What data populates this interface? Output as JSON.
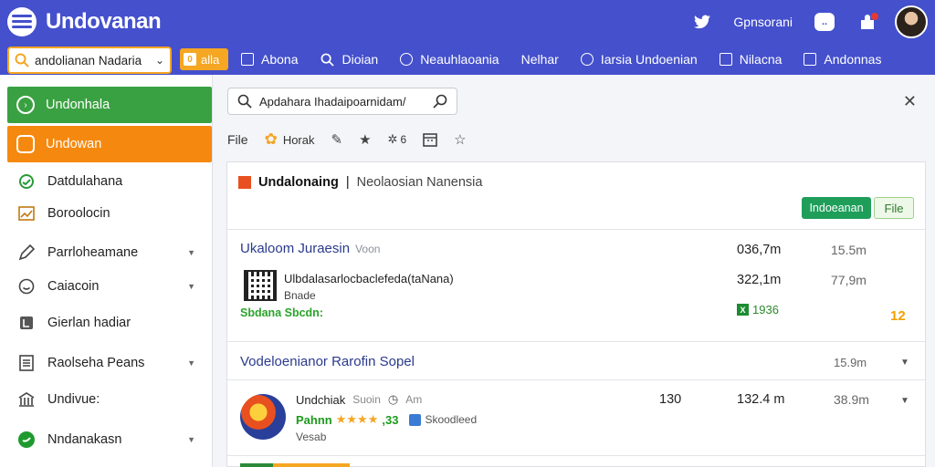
{
  "app": {
    "title": "Undovanan"
  },
  "header": {
    "right_link": "Gpnsorani",
    "chat_icon_text": "..",
    "select": {
      "value": "andolianan Nadaria"
    },
    "badge_button": {
      "label": "alla",
      "icon_text": "0"
    },
    "nav": [
      {
        "label": "Abona",
        "icon": "box-icon"
      },
      {
        "label": "Dioian",
        "icon": "search-icon"
      },
      {
        "label": "Neauhlaoania",
        "icon": "circle-check-icon"
      },
      {
        "label": "Nelhar",
        "icon": ""
      },
      {
        "label": "Iarsia Undoenian",
        "icon": "circle-icon"
      },
      {
        "label": "Nilacna",
        "icon": "box-icon"
      },
      {
        "label": "Andonnas",
        "icon": "box-icon"
      }
    ]
  },
  "sidebar": {
    "items": [
      {
        "label": "Undonhala",
        "icon": "arrow-circle-icon",
        "style": "green"
      },
      {
        "label": "Undowan",
        "icon": "chat-icon",
        "style": "orange"
      },
      {
        "label": "Datdulahana",
        "icon": "leaf-icon"
      },
      {
        "label": "Boroolocin",
        "icon": "chart-icon"
      },
      {
        "label": "Parrloheamane",
        "icon": "pen-icon",
        "chevron": true
      },
      {
        "label": "Caiacoin",
        "icon": "smile-icon",
        "chevron": true
      },
      {
        "label": "Gierlan hadiar",
        "icon": "square-icon"
      },
      {
        "label": "Raolseha Peans",
        "icon": "document-icon",
        "chevron": true
      },
      {
        "label": "Undivue:",
        "icon": "building-icon"
      },
      {
        "label": "Nndanakasn",
        "icon": "green-dot-icon",
        "chevron": true
      }
    ]
  },
  "main": {
    "search": {
      "value": "Apdahara Ihadaipoarnidam/"
    },
    "toolbar": {
      "file_label": "File",
      "flower_label": "Horak",
      "star_count": "6"
    },
    "panel": {
      "title": "Undalonaing",
      "separator": "|",
      "subtitle": "Neolaosian Nanensia",
      "btn_primary": "Indoeanan",
      "btn_secondary": "File",
      "row1": {
        "title": "Ukaloom Juraesin",
        "title_dim": "Voon",
        "val1": "036,7m",
        "val2": "15.5m",
        "line1": "Ulbdalasarlocbaclefeda(taNana)",
        "line2": "Bnade",
        "green_text": "Sbdana Sbcdn:",
        "val3": "322,1m",
        "val4": "77,9m",
        "badge_letter": "X",
        "badge_value": "1936",
        "amber": "12"
      },
      "row2": {
        "title": "Vodeloenianor Rarofin Sopel",
        "val": "15.9m"
      },
      "row3": {
        "name": "Undchiak",
        "name_dim": "Suoin",
        "tag": "Am",
        "rating_prefix": "Pahnn",
        "stars": "★★★★",
        "rating_suffix": ",33",
        "desc": "Skoodleed",
        "sub": "Vesab",
        "val1": "130",
        "val2": "132.4 m",
        "val3": "38.9m"
      }
    }
  }
}
